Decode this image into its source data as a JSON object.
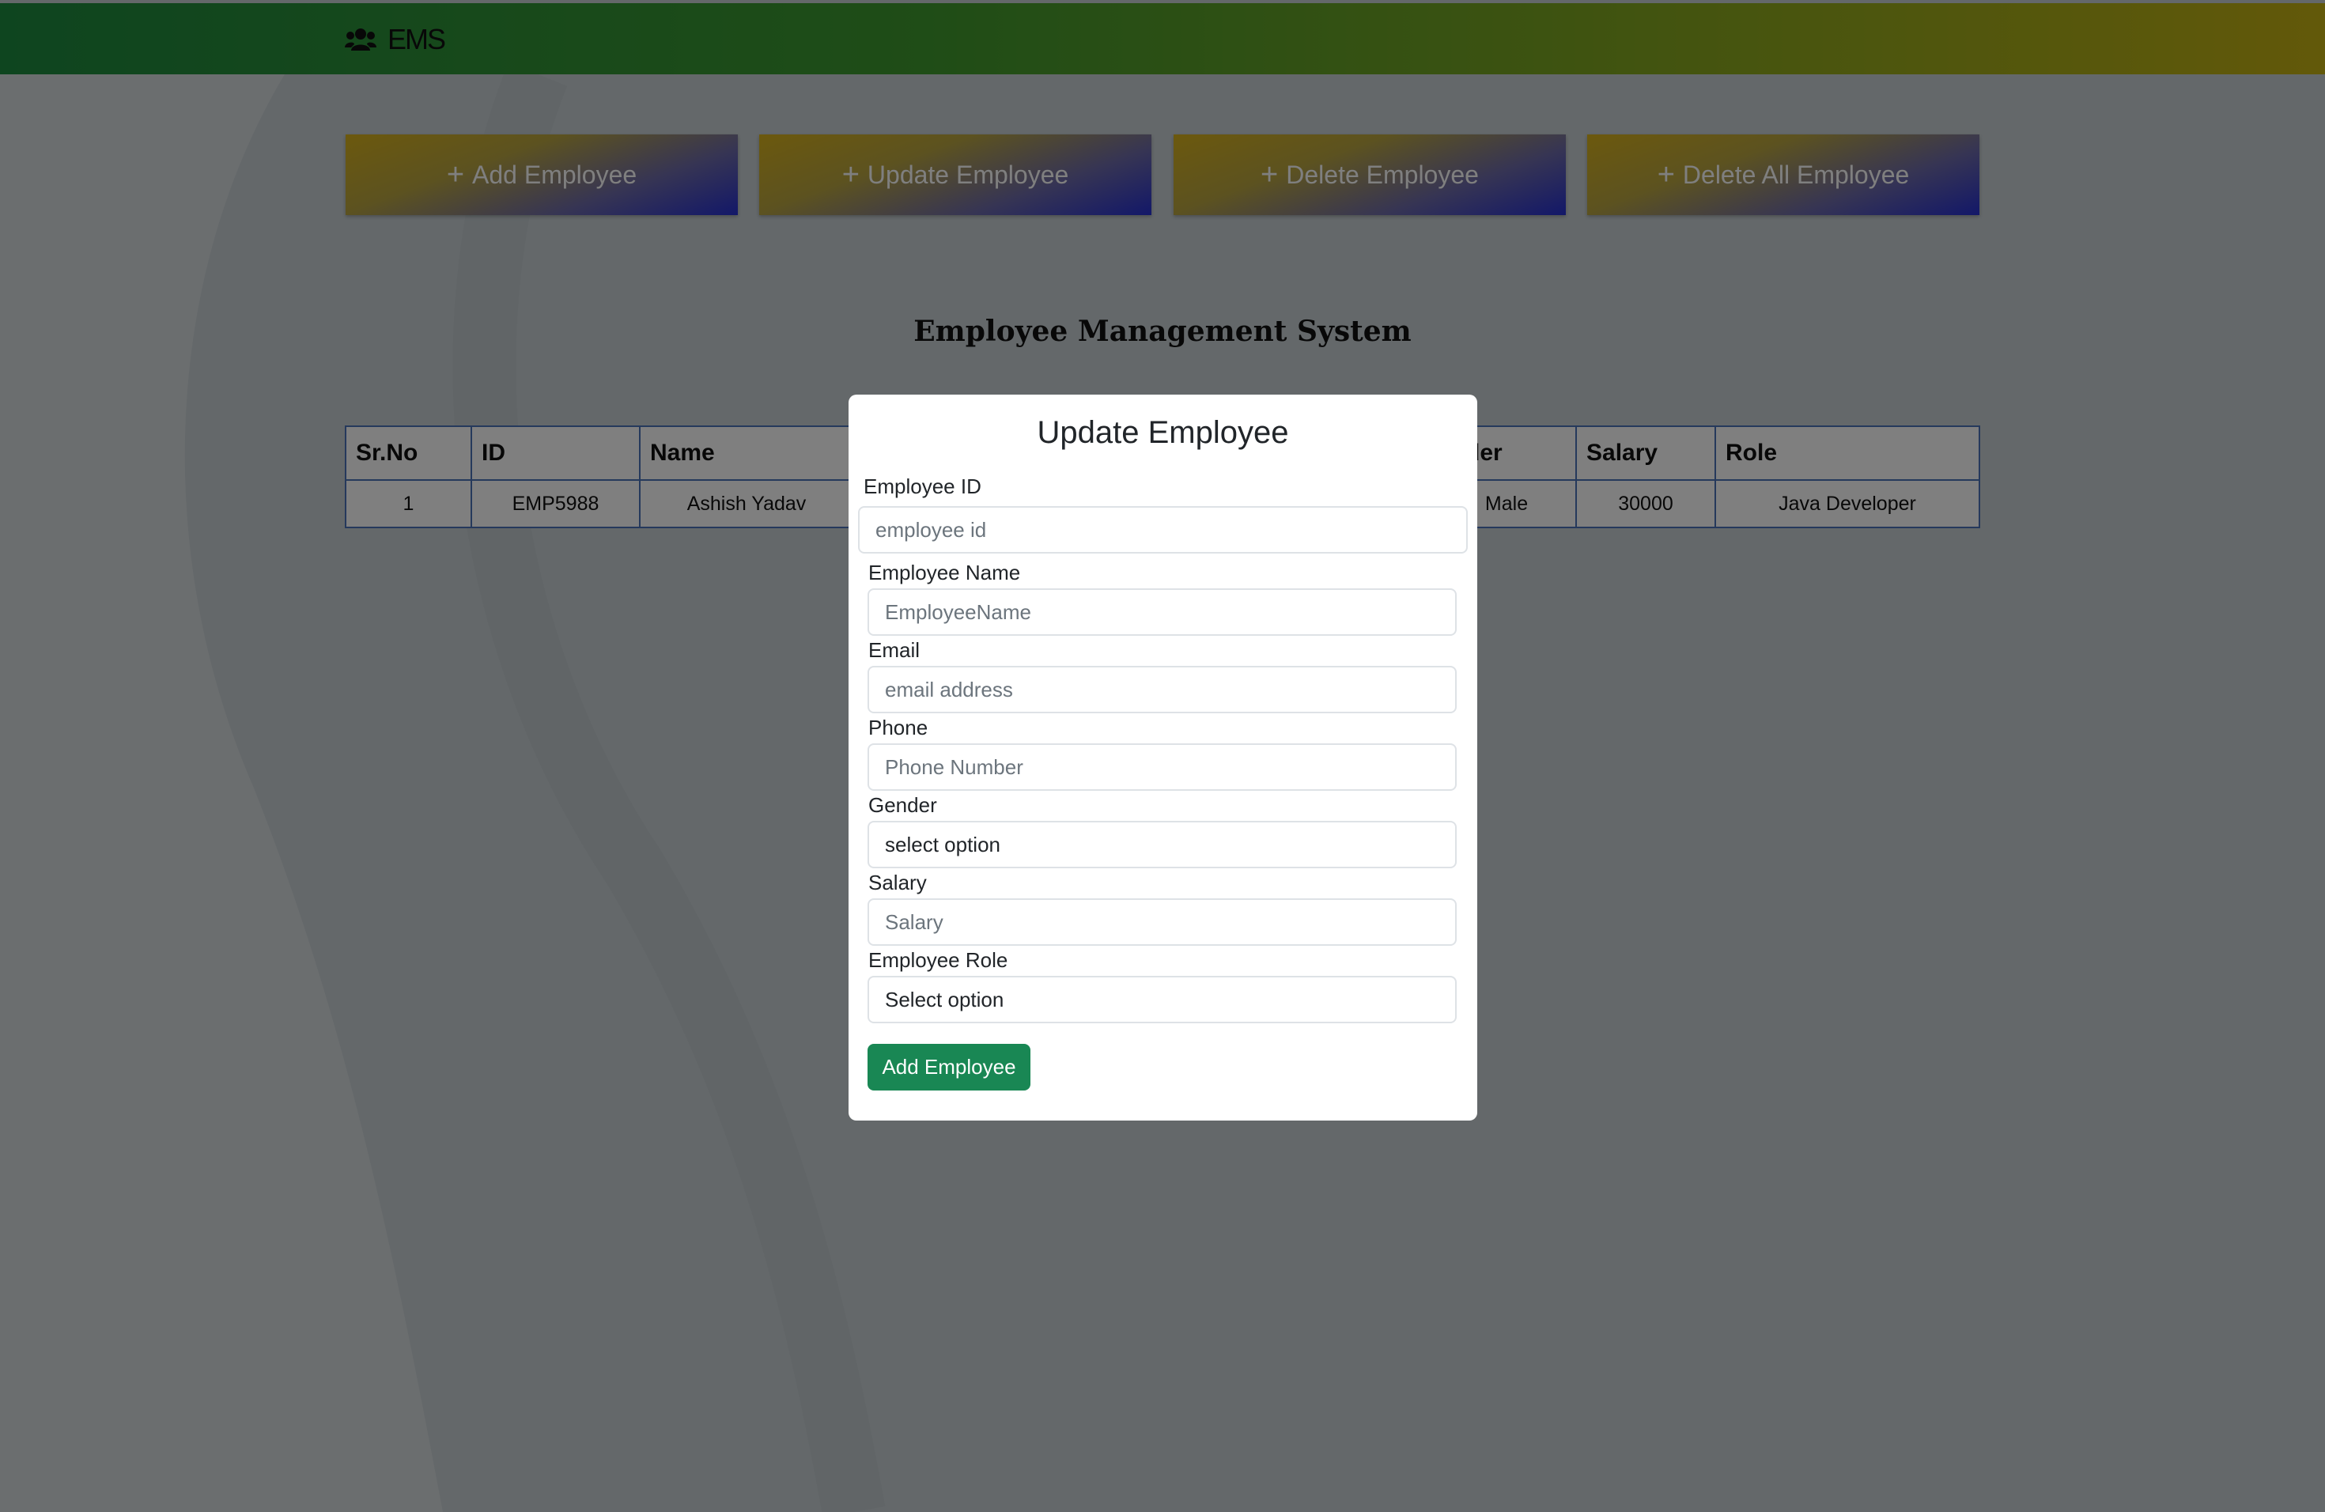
{
  "navbar": {
    "brand": "EMS",
    "brand_icon": "users-icon"
  },
  "actions": {
    "add": "Add Employee",
    "update": "Update Employee",
    "delete": "Delete Employee",
    "delete_all": "Delete All Employee"
  },
  "page_title": "Employee Management System",
  "table": {
    "headers": [
      "Sr.No",
      "ID",
      "Name",
      "ender",
      "Salary",
      "Role"
    ],
    "rows": [
      {
        "sr": "1",
        "id": "EMP5988",
        "name": "Ashish Yadav",
        "gender": "Male",
        "salary": "30000",
        "role": "Java Developer"
      }
    ]
  },
  "modal": {
    "title": "Update Employee",
    "fields": {
      "employee_id": {
        "label": "Employee ID",
        "placeholder": "employee id"
      },
      "employee_name": {
        "label": "Employee Name",
        "placeholder": "EmployeeName"
      },
      "email": {
        "label": "Email",
        "placeholder": "email address"
      },
      "phone": {
        "label": "Phone",
        "placeholder": "Phone Number"
      },
      "gender": {
        "label": "Gender",
        "value": "select option"
      },
      "salary": {
        "label": "Salary",
        "placeholder": "Salary"
      },
      "role": {
        "label": "Employee Role",
        "value": "Select option"
      }
    },
    "submit": "Add Employee"
  },
  "colors": {
    "submit_green": "#198754",
    "table_border": "#4a73b8"
  }
}
